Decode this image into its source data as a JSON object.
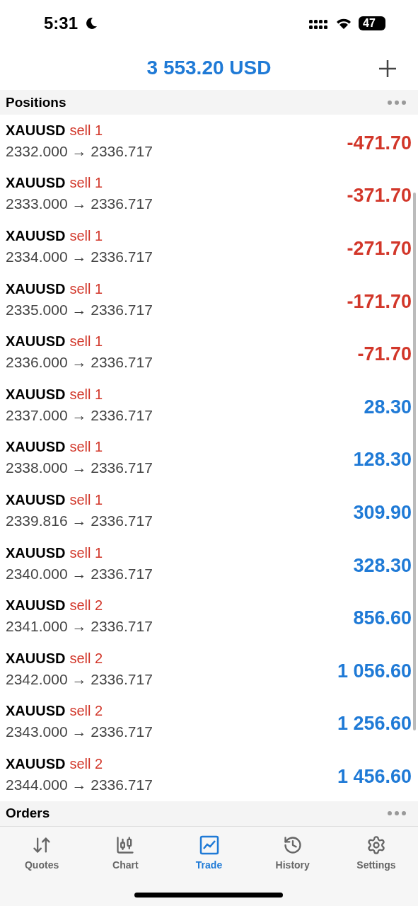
{
  "status_bar": {
    "time": "5:31",
    "battery": "47"
  },
  "header": {
    "balance": "3 553.20 USD"
  },
  "positions": {
    "title": "Positions",
    "rows": [
      {
        "symbol": "XAUUSD",
        "side": "sell 1",
        "prices": "2332.000 → 2336.717",
        "profit": "-471.70",
        "kind": "loss"
      },
      {
        "symbol": "XAUUSD",
        "side": "sell 1",
        "prices": "2333.000 → 2336.717",
        "profit": "-371.70",
        "kind": "loss"
      },
      {
        "symbol": "XAUUSD",
        "side": "sell 1",
        "prices": "2334.000 → 2336.717",
        "profit": "-271.70",
        "kind": "loss"
      },
      {
        "symbol": "XAUUSD",
        "side": "sell 1",
        "prices": "2335.000 → 2336.717",
        "profit": "-171.70",
        "kind": "loss"
      },
      {
        "symbol": "XAUUSD",
        "side": "sell 1",
        "prices": "2336.000 → 2336.717",
        "profit": "-71.70",
        "kind": "loss"
      },
      {
        "symbol": "XAUUSD",
        "side": "sell 1",
        "prices": "2337.000 → 2336.717",
        "profit": "28.30",
        "kind": "gain"
      },
      {
        "symbol": "XAUUSD",
        "side": "sell 1",
        "prices": "2338.000 → 2336.717",
        "profit": "128.30",
        "kind": "gain"
      },
      {
        "symbol": "XAUUSD",
        "side": "sell 1",
        "prices": "2339.816 → 2336.717",
        "profit": "309.90",
        "kind": "gain"
      },
      {
        "symbol": "XAUUSD",
        "side": "sell 1",
        "prices": "2340.000 → 2336.717",
        "profit": "328.30",
        "kind": "gain"
      },
      {
        "symbol": "XAUUSD",
        "side": "sell 2",
        "prices": "2341.000 → 2336.717",
        "profit": "856.60",
        "kind": "gain"
      },
      {
        "symbol": "XAUUSD",
        "side": "sell 2",
        "prices": "2342.000 → 2336.717",
        "profit": "1 056.60",
        "kind": "gain"
      },
      {
        "symbol": "XAUUSD",
        "side": "sell 2",
        "prices": "2343.000 → 2336.717",
        "profit": "1 256.60",
        "kind": "gain"
      },
      {
        "symbol": "XAUUSD",
        "side": "sell 2",
        "prices": "2344.000 → 2336.717",
        "profit": "1 456.60",
        "kind": "gain"
      }
    ]
  },
  "orders": {
    "title": "Orders"
  },
  "tabs": [
    {
      "label": "Quotes",
      "kind": "quotes",
      "selected": false
    },
    {
      "label": "Chart",
      "kind": "chart",
      "selected": false
    },
    {
      "label": "Trade",
      "kind": "trade",
      "selected": true
    },
    {
      "label": "History",
      "kind": "history",
      "selected": false
    },
    {
      "label": "Settings",
      "kind": "settings",
      "selected": false
    }
  ]
}
